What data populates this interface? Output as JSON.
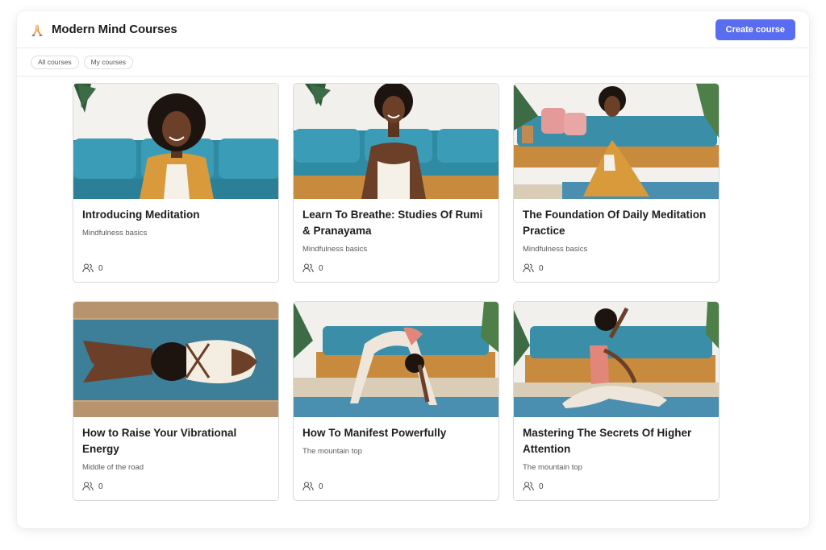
{
  "app": {
    "title": "Modern Mind Courses",
    "logo_icon": "praying-hands-icon",
    "create_label": "Create course",
    "accent": "#5a6df0"
  },
  "filters": [
    "All courses",
    "My courses"
  ],
  "courses": [
    {
      "title": "Introducing Meditation",
      "subtitle": "Mindfulness basics",
      "members": "0"
    },
    {
      "title": "Learn To Breathe: Studies Of Rumi & Pranayama",
      "subtitle": "Mindfulness basics",
      "members": "0"
    },
    {
      "title": "The Foundation Of Daily Meditation Practice",
      "subtitle": "Mindfulness basics",
      "members": "0"
    },
    {
      "title": "How to Raise Your Vibrational Energy",
      "subtitle": "Middle of the road",
      "members": "0"
    },
    {
      "title": "How To Manifest Powerfully",
      "subtitle": "The mountain top",
      "members": "0"
    },
    {
      "title": "Mastering The Secrets Of Higher Attention",
      "subtitle": "The mountain top",
      "members": "0"
    }
  ],
  "icons": {
    "members": "users-icon"
  }
}
